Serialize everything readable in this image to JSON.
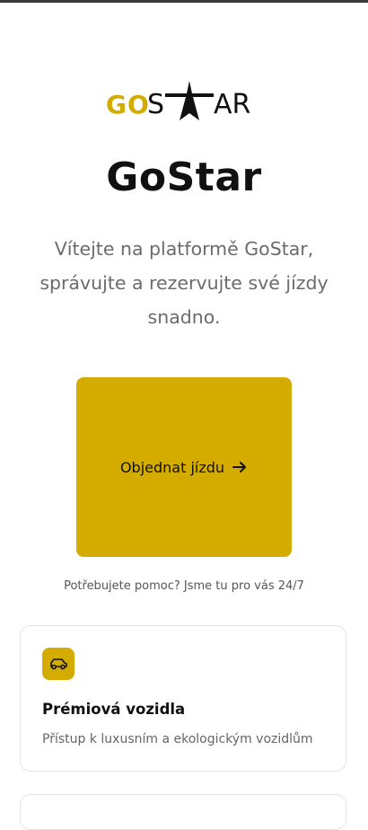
{
  "brand": {
    "logo_text_go": "GO",
    "logo_text_star": "STAR",
    "title": "GoStar"
  },
  "hero": {
    "subtitle": "Vítejte na platformě GoStar, správujte a rezervujte své jízdy snadno."
  },
  "cta": {
    "label": "Objednat jízdu"
  },
  "help": {
    "text": "Potřebujete pomoc? Jsme tu pro vás 24/7"
  },
  "features": [
    {
      "icon": "car-icon",
      "title": "Prémiová vozidla",
      "description": "Přístup k luxusním a ekologickým vozidlům"
    }
  ],
  "colors": {
    "accent": "#d4ac00",
    "text": "#111111",
    "muted": "#6b6b6b"
  }
}
